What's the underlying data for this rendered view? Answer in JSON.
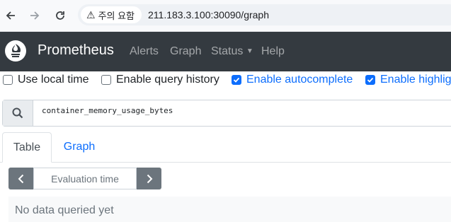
{
  "browser": {
    "back_icon": "arrow-left-icon",
    "forward_icon": "arrow-right-icon",
    "reload_icon": "reload-icon",
    "security_label": "주의 요함",
    "url": "211.183.3.100:30090/graph"
  },
  "navbar": {
    "brand": "Prometheus",
    "links": [
      "Alerts",
      "Graph",
      "Status",
      "Help"
    ],
    "bg_color": "#343a40"
  },
  "options": [
    {
      "label": "Use local time",
      "checked": false
    },
    {
      "label": "Enable query history",
      "checked": false
    },
    {
      "label": "Enable autocomplete",
      "checked": true
    },
    {
      "label": "Enable highlig",
      "checked": true
    }
  ],
  "query": {
    "value": "container_memory_usage_bytes",
    "icon": "search-icon"
  },
  "tabs": [
    {
      "label": "Table",
      "active": true
    },
    {
      "label": "Graph",
      "active": false
    }
  ],
  "eval": {
    "placeholder": "Evaluation time",
    "prev_icon": "chevron-left-icon",
    "next_icon": "chevron-right-icon"
  },
  "result": {
    "message": "No data queried yet"
  }
}
